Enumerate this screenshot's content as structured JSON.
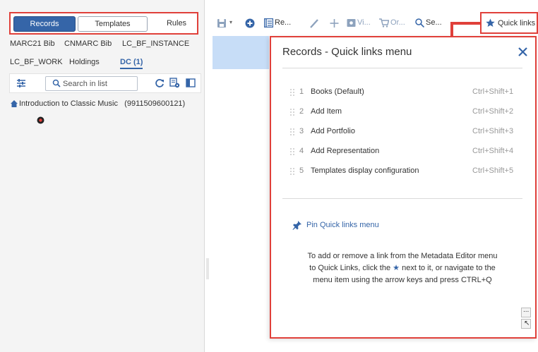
{
  "mode_tabs": {
    "records": "Records",
    "templates": "Templates",
    "rules": "Rules"
  },
  "category_tabs": [
    "MARC21 Bib",
    "CNMARC Bib",
    "LC_BF_INSTANCE",
    "LC_BF_WORK",
    "Holdings",
    "DC (1)"
  ],
  "search": {
    "placeholder": "Search in list",
    "value": ""
  },
  "record": {
    "title": "Introduction to Classic Music",
    "id": "(9911509600121)"
  },
  "toolbar": {
    "records_label": "Re...",
    "view_label": "Vi...",
    "order_label": "Or...",
    "search_label": "Se...",
    "quick_links_label": "Quick links"
  },
  "quick_links_panel": {
    "title": "Records - Quick links menu",
    "items": [
      {
        "num": "1",
        "label": "Books (Default)",
        "shortcut": "Ctrl+Shift+1"
      },
      {
        "num": "2",
        "label": "Add Item",
        "shortcut": "Ctrl+Shift+2"
      },
      {
        "num": "3",
        "label": "Add Portfolio",
        "shortcut": "Ctrl+Shift+3"
      },
      {
        "num": "4",
        "label": "Add Representation",
        "shortcut": "Ctrl+Shift+4"
      },
      {
        "num": "5",
        "label": "Templates display configuration",
        "shortcut": "Ctrl+Shift+5"
      }
    ],
    "pin_label": "Pin Quick links menu",
    "help_line1": "To add or remove a link from the Metadata Editor menu",
    "help_line2_before": "to Quick Links, click the",
    "help_line2_star": "★",
    "help_line2_after": "next to it, or navigate to the",
    "help_line3": "menu item using the arrow keys and press CTRL+Q",
    "more_label": "...",
    "arrow_label": "↖"
  },
  "colors": {
    "accent": "#3565a8",
    "highlight": "#e0403a",
    "selection": "#c7ddf7"
  }
}
